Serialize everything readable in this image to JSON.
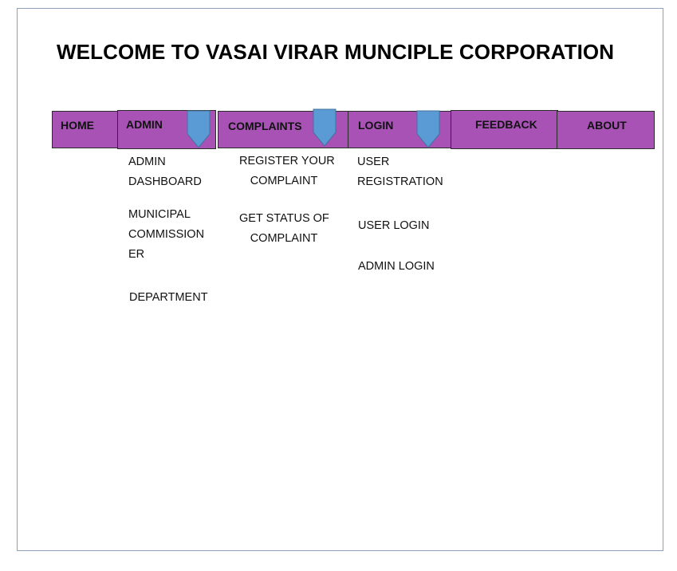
{
  "page": {
    "title": "WELCOME TO VASAI VIRAR MUNCIPLE CORPORATION"
  },
  "nav": {
    "home": "HOME",
    "admin": "ADMIN",
    "complaints": "COMPLAINTS",
    "login": "LOGIN",
    "feedback": "FEEDBACK",
    "about": "ABOUT"
  },
  "menus": {
    "admin": {
      "dashboard": [
        "ADMIN",
        "DASHBOARD"
      ],
      "commissioner": [
        "MUNICIPAL",
        "COMMISSION",
        "ER"
      ],
      "department": "DEPARTMENT"
    },
    "complaints": {
      "register": [
        "REGISTER YOUR",
        "COMPLAINT"
      ],
      "status": [
        "GET STATUS OF",
        "COMPLAINT"
      ]
    },
    "login": {
      "registration": [
        "USER",
        "REGISTRATION"
      ],
      "user_login": "USER LOGIN",
      "admin_login": "ADMIN LOGIN"
    }
  },
  "colors": {
    "nav_background": "#a852b6",
    "dropdown_arrow": "#5b9bd5",
    "frame_border": "#8ea0b8"
  },
  "icons": {
    "dropdown": "chevron-down-icon"
  }
}
